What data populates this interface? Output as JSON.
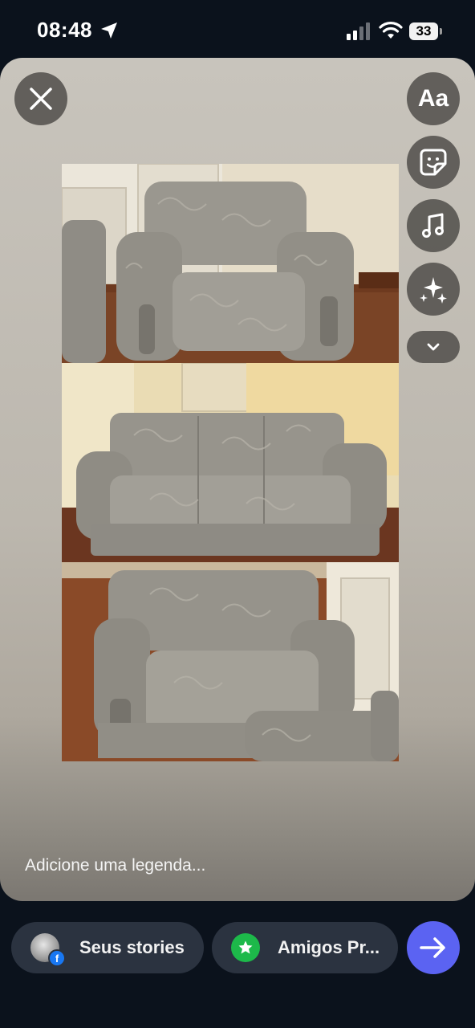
{
  "status_bar": {
    "time": "08:48",
    "battery": "33",
    "icons": [
      "location-arrow-icon",
      "cellular-signal-icon",
      "wifi-icon",
      "battery-icon"
    ]
  },
  "editor": {
    "tools": [
      {
        "name": "text-tool",
        "label": "Aa"
      },
      {
        "name": "sticker-tool",
        "icon": "sticker-icon"
      },
      {
        "name": "music-tool",
        "icon": "music-note-icon"
      },
      {
        "name": "effects-tool",
        "icon": "sparkles-icon"
      },
      {
        "name": "more-tools",
        "icon": "chevron-down-icon"
      }
    ],
    "close_icon": "close-icon",
    "photos": [
      "armchair photo",
      "three-seat sofa photo",
      "two-seat sofa photo"
    ],
    "caption_placeholder": "Adicione uma legenda..."
  },
  "share_bar": {
    "your_stories_label": "Seus stories",
    "close_friends_label": "Amigos Pr...",
    "send_icon": "arrow-right-icon"
  },
  "colors": {
    "background": "#0b121c",
    "pill": "#2b3340",
    "send_button": "#5b63f2",
    "close_friends_green": "#1db94a",
    "facebook_blue": "#1877f2"
  }
}
